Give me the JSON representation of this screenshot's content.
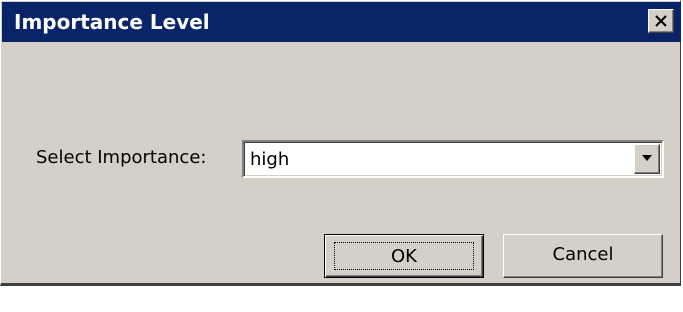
{
  "window": {
    "title": "Importance Level",
    "close_icon": "close-x-icon"
  },
  "form": {
    "label": "Select Importance:",
    "importance_value": "high",
    "dropdown_icon": "chevron-down-icon"
  },
  "buttons": {
    "ok_label": "OK",
    "cancel_label": "Cancel"
  },
  "colors": {
    "titlebar": "#0a246a",
    "dialog_face": "#d4d0c8"
  }
}
